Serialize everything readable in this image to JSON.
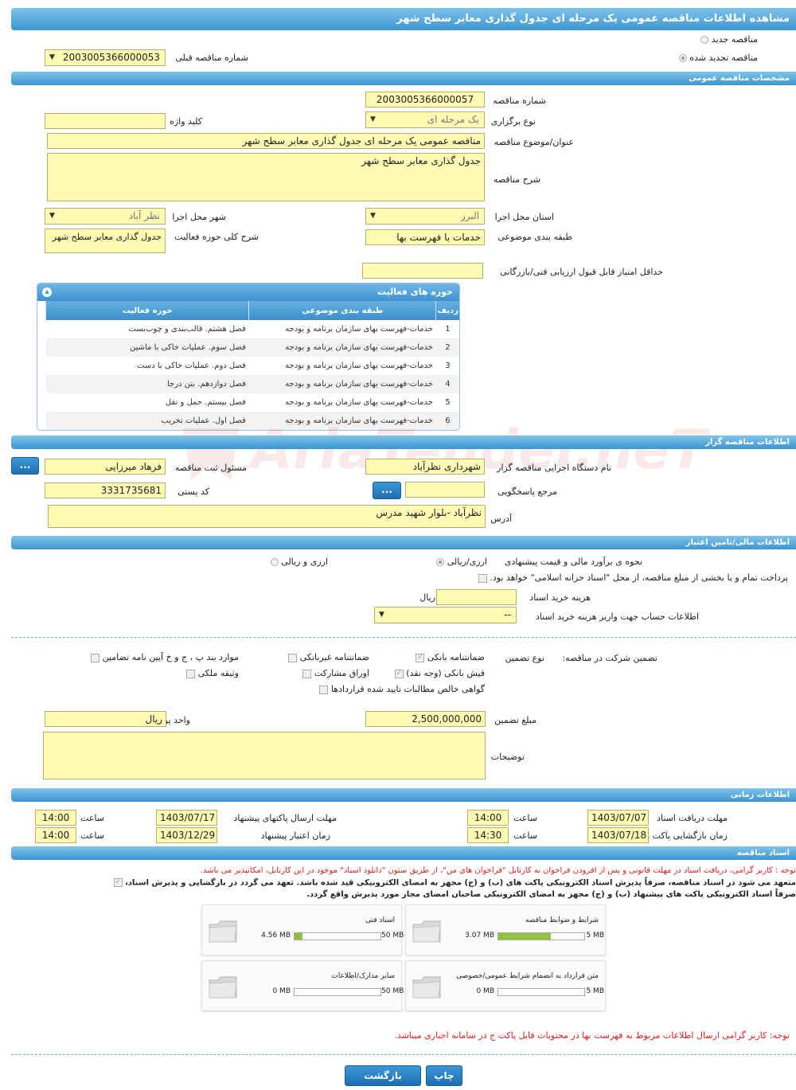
{
  "title": "مشاهده اطلاعات مناقصه عمومی یک مرحله ای جدول گذاری معابر سطح شهر",
  "top": {
    "radio_new": "مناقصه جدید",
    "radio_renew": "مناقصه تجدید شده",
    "prev_number_label": "شماره مناقصه قبلی",
    "prev_number_value": "2003005366000053"
  },
  "general": {
    "header": "مشخصات مناقصه عمومی",
    "number_label": "شماره مناقصه",
    "number_value": "2003005366000057",
    "type_label": "نوع برگزاری",
    "type_value": "یک مرحله ای",
    "keyword_label": "کلید واژه",
    "keyword_value": "",
    "subject_label": "عنوان/موضوع مناقصه",
    "subject_value": "مناقصه عمومی یک مرحله ای جدول گذاری معابر سطح شهر",
    "desc_label": "شرح مناقصه",
    "desc_value": "جدول گذاری معابر سطح شهر",
    "province_label": "استان محل اجرا",
    "province_value": "البرز",
    "city_label": "شهر محل اجرا",
    "city_value": "نظر آباد",
    "category_label": "طبقه بندی موضوعی",
    "category_value": "خدمات با فهرست بها",
    "scope_label": "شرح کلی حوزه فعالیت",
    "scope_value": "جدول گذاری معابر سطح شهر",
    "min_score_label": "حداقل امتیاز قابل قبول ارزیابی فنی/بازرگانی",
    "min_score_value": ""
  },
  "activities": {
    "title": "حوزه های فعالیت",
    "columns": [
      "ردیف",
      "طبقه بندی موضوعی",
      "حوزه فعالیت"
    ],
    "rows": [
      [
        "1",
        "خدمات-فهرست بهای سازمان برنامه و بودجه",
        "فصل هشتم. قالب‌بندی و چوب‌بست"
      ],
      [
        "2",
        "خدمات-فهرست بهای سازمان برنامه و بودجه",
        "فصل سوم. عملیات خاکی با ماشین"
      ],
      [
        "3",
        "خدمات-فهرست بهای سازمان برنامه و بودجه",
        "فصل دوم. عملیات خاکی با دست"
      ],
      [
        "4",
        "خدمات-فهرست بهای سازمان برنامه و بودجه",
        "فصل دوازدهم. بتن درجا"
      ],
      [
        "5",
        "خدمات-فهرست بهای سازمان برنامه و بودجه",
        "فصل بیستم. حمل و نقل"
      ],
      [
        "6",
        "خدمات-فهرست بهای سازمان برنامه و بودجه",
        "فصل اول. عملیات تخریب"
      ]
    ]
  },
  "organizer": {
    "header": "اطلاعات مناقصه گزار",
    "org_label": "نام دستگاه اجرایی مناقصه گزار",
    "org_value": "شهرداری نظرآباد",
    "resp_label": "مسئول ثبت مناقصه",
    "resp_value": "فرهاد  میرزایی",
    "ref_label": "مرجع پاسخگویی",
    "ref_value": "",
    "postal_label": "کد پستی",
    "postal_value": "3331735681",
    "address_label": "آدرس",
    "address_value": "نظرآباد -بلوار شهید مدرس",
    "more_btn": "..."
  },
  "finance": {
    "header": "اطلاعات مالی/تامین اعتبار",
    "estimate_label": "نحوه ی برآورد مالی و قیمت پیشنهادی",
    "opt_rial": "ارزی/ریالی",
    "opt_both": "ارزی و ریالی",
    "treasury_text": "پرداخت تمام و یا بخشی از مبلغ مناقصه، از محل \"اسناد خزانه اسلامی\" خواهد بود.",
    "doc_cost_label": "هزینه خرید اسناد",
    "doc_cost_unit": "ریال",
    "doc_cost_value": "",
    "account_label": "اطلاعات حساب جهت واریز هزینه خرید اسناد",
    "account_value": "--"
  },
  "guarantee": {
    "label": "تضمین شرکت در مناقصه:",
    "type_label": "نوع تضمین",
    "opts": {
      "bank_guarantee": "ضمانتنامه بانکی",
      "nonbank_guarantee": "ضمانتنامه غیربانکی",
      "clauses": "موارد بند پ ، ج و خ آیین نامه تضامین",
      "bank_receipt": "فیش بانکی (وجه نقد)",
      "bonds": "اوراق مشارکت",
      "property": "وثیقه ملکی",
      "receivables": "گواهی خالص مطالبات تایید شده قراردادها"
    },
    "amount_label": "مبلغ تضمین",
    "amount_value": "2,500,000,000",
    "currency_label": "واحد پول",
    "currency_value": "ریال",
    "notes_label": "توضیحات",
    "notes_value": ""
  },
  "timing": {
    "header": "اطلاعات زمانی",
    "receive_label": "مهلت دریافت اسناد",
    "receive_date": "1403/07/07",
    "receive_time": "14:00",
    "send_label": "مهلت ارسال پاکتهای پیشنهاد",
    "send_date": "1403/07/17",
    "send_time": "14:00",
    "open_label": "زمان بازگشایی پاکت ها",
    "open_date": "1403/07/18",
    "open_time": "14:30",
    "validity_label": "زمان اعتبار پیشنهاد",
    "validity_date": "1403/12/29",
    "validity_time": "14:00",
    "time_label": "ساعت"
  },
  "docs": {
    "header": "اسناد مناقصه",
    "note1": "توجه : کاربر گرامی، دریافت اسناد در مهلت قانونی و پس از افزودن فراخوان به کارتابل \"فراخوان های من\"، از طریق ستون \"دانلود اسناد\" موجود در این کارتابل، امکانپذیر می باشد.",
    "commit_line1": "متعهد می شود در اسناد مناقصه، صرفاً پذیرش اسناد الکترونیکی پاکت های (ب) و (ج) مجهز به امضای الکترونیکی قید شده باشد. تعهد می گردد در بازگشایی و پذیرش اسناد،",
    "commit_line2": "صرفاً اسناد الکترونیکی پاکت های پیشنهاد (ب) و (ج) مجهز به امضای الکترونیکی صاحبان امضای مجاز مورد پذیرش واقع گردد.",
    "files": [
      {
        "name": "شرایط و ضوابط مناقصه",
        "max": "5 MB",
        "current": "3.07 MB",
        "fraction": 0.614
      },
      {
        "name": "اسناد فنی",
        "max": "50 MB",
        "current": "4.56 MB",
        "fraction": 0.0912
      },
      {
        "name": "متن قرارداد به انضمام شرایط عمومی/خصوصی",
        "max": "5 MB",
        "current": "0 MB",
        "fraction": 0
      },
      {
        "name": "سایر مدارک/اطلاعات",
        "max": "50 MB",
        "current": "0 MB",
        "fraction": 0
      }
    ],
    "note2": "توجه: کاربر گرامی ارسال اطلاعات مربوط به فهرست بها در محتویات فایل پاکت ج در سامانه اجباری میباشد."
  },
  "buttons": {
    "print": "چاپ",
    "back": "بازگشت"
  },
  "watermark": "AriaTender.neT"
}
